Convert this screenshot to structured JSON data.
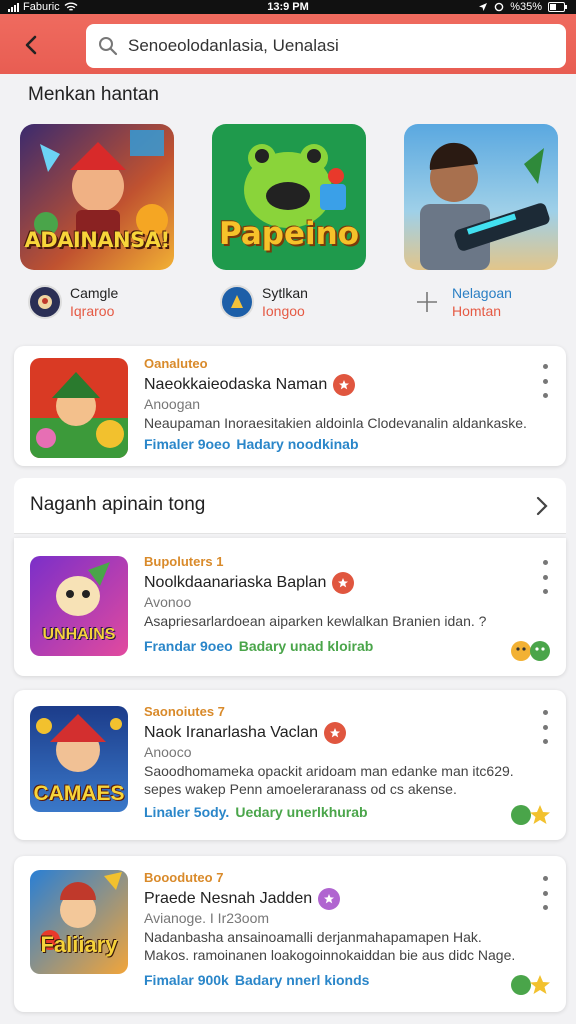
{
  "status_bar": {
    "carrier": "Faburic",
    "time": "13:9 PM",
    "battery": "%35%"
  },
  "header": {
    "search_text": "Senoeolodanlasia, Uenalasi"
  },
  "section_title": "Menkan hantan",
  "featured": [
    {
      "banner": "ADAINANSA!",
      "line1": "Camgle",
      "line2": "Iqraroo"
    },
    {
      "banner": "Papeino",
      "line1": "Sytlkan",
      "line2": "Iongoo"
    },
    {
      "banner": "",
      "line1": "Nelagoan",
      "line2": "Homtan"
    }
  ],
  "top_card": {
    "category": "Oanaluteo",
    "name": "Naeokkaieodaska Naman",
    "sub": "Anoogan",
    "desc": "Neaupaman Inoraesitakien aldoinla Clodevanalin aldankaske.",
    "meta_a": "Fimaler 9oeo",
    "meta_b": "Hadary noodkinab"
  },
  "row_header": {
    "title": "Naganh apinain tong"
  },
  "list": [
    {
      "category": "Bupoluters 1",
      "name": "Noolkdaanariaska Baplan",
      "sub": "Avonoo",
      "desc": "Asapriesarlardoean aiparken kewlalkan Branien idan. ?",
      "meta_a": "Frandar 9oeo",
      "meta_b": "Badary unad kloirab",
      "banner": "UNHAINS"
    },
    {
      "category": "Saonoiutes 7",
      "name": "Naok Iranarlasha Vaclan",
      "sub": "Anooco",
      "desc": "Saoodhomameka opackit aridoam man edanke man itc629. sepes wakep Penn amoeleraranass od cs akense.",
      "meta_a": "Linaler 5ody.",
      "meta_b": "Uedary unerlkhurab",
      "banner": "CAMAES"
    },
    {
      "category": "Boooduteo 7",
      "name": "Praede Nesnah Jadden",
      "sub": "Avianoge. I Ir23oom",
      "desc": "Nadanbasha ansainoamalli derjanmahapamapen Hak. Makos. ramoinanen loakogoinnokaiddan bie aus didc Nage.",
      "meta_a": "Fimalar 900k",
      "meta_b": "Badary nnerl kionds",
      "banner": "Faliiary"
    }
  ],
  "colors": {
    "header": "#e85d52",
    "category": "#d98a2a",
    "meta_a": "#2a86c9",
    "meta_b": "#4aa54a"
  }
}
